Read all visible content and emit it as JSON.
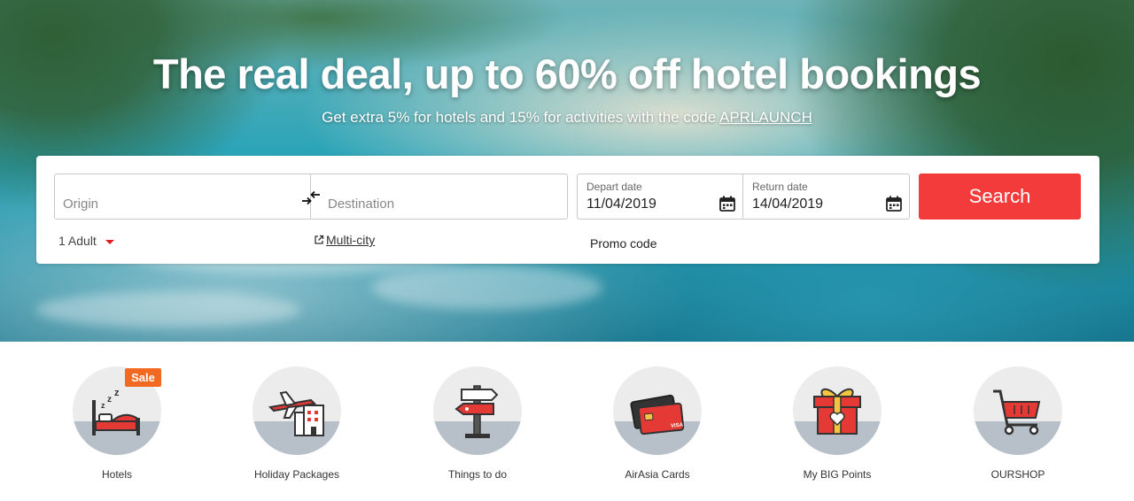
{
  "hero": {
    "title": "The real deal, up to 60% off hotel bookings",
    "subtitle_prefix": "Get extra 5% for hotels and 15% for activities with the code",
    "promo_code": "APRLAUNCH"
  },
  "search": {
    "origin_placeholder": "Origin",
    "destination_placeholder": "Destination",
    "swap_icon": "swap-arrows-icon",
    "depart_label": "Depart date",
    "depart_value": "11/04/2019",
    "return_label": "Return date",
    "return_value": "14/04/2019",
    "calendar_icon": "calendar-icon",
    "button_label": "Search",
    "passengers": "1 Adult",
    "multicity_label": "Multi-city",
    "promo_label": "Promo code"
  },
  "categories": [
    {
      "label": "Hotels",
      "icon": "hotel-bed-icon",
      "badge": "Sale"
    },
    {
      "label": "Holiday Packages",
      "icon": "plane-building-icon"
    },
    {
      "label": "Things to do",
      "icon": "signpost-icon"
    },
    {
      "label": "AirAsia Cards",
      "icon": "credit-card-icon",
      "card_text": "VISA"
    },
    {
      "label": "My BIG Points",
      "icon": "gift-box-icon"
    },
    {
      "label": "OURSHOP",
      "icon": "shopping-cart-icon"
    }
  ],
  "colors": {
    "accent_red": "#f33b3b",
    "sale_orange": "#f26a22",
    "circle_bg": "#ececec",
    "circle_ground": "#b7c0c8"
  }
}
